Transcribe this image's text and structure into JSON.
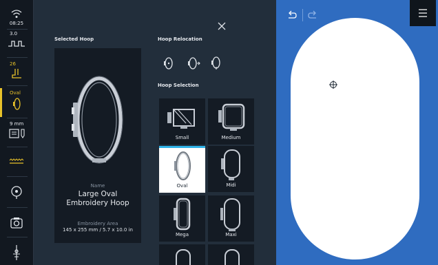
{
  "sidebar": {
    "time": "08:25",
    "stitch_width": "3.0",
    "presser_value": "26",
    "hoop_value": "Oval",
    "foot_value": "9 mm"
  },
  "panel": {
    "selected_hoop_title": "Selected Hoop",
    "name_label": "Name",
    "hoop_name": "Large Oval Embroidery Hoop",
    "area_label": "Embroidery Area",
    "area_value": "145 x 255 mm / 5.7 x 10.0 in",
    "relocation_title": "Hoop Relocation",
    "selection_title": "Hoop Selection",
    "hoops": [
      {
        "label": "Small"
      },
      {
        "label": "Medium"
      },
      {
        "label": "Oval",
        "selected": true
      },
      {
        "label": "Midi"
      },
      {
        "label": "Mega"
      },
      {
        "label": "Maxi"
      }
    ]
  },
  "colors": {
    "accent_yellow": "#e8c22a",
    "selection_blue": "#2fb3e8",
    "canvas_blue": "#2f6cc0"
  }
}
